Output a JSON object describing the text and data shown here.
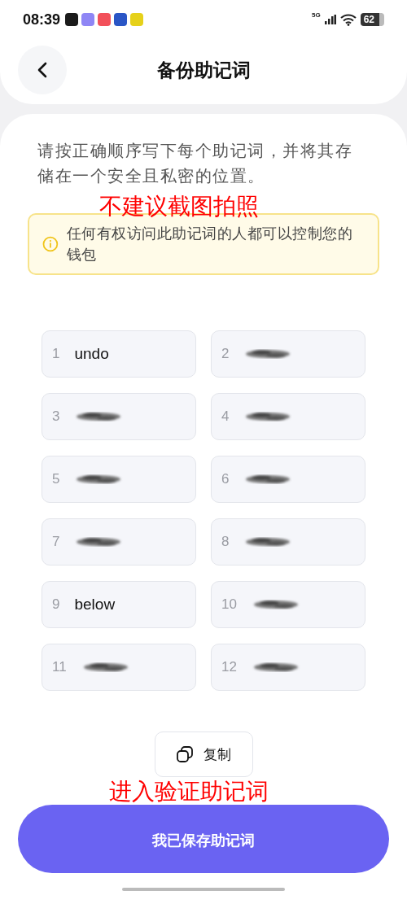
{
  "status_bar": {
    "time": "08:39",
    "app_icons": [
      {
        "color": "#1b1b1b"
      },
      {
        "color": "#8f86f5"
      },
      {
        "color": "#f2505a"
      },
      {
        "color": "#2a56c6"
      },
      {
        "color": "#e6d11a"
      }
    ],
    "network": "5G",
    "battery": "62"
  },
  "header": {
    "title": "备份助记词"
  },
  "instruction": "请按正确顺序写下每个助记词，并将其存储在一个安全且私密的位置。",
  "notice": {
    "annotation": "不建议截图拍照",
    "text": "任何有权访问此助记词的人都可以控制您的钱包"
  },
  "words": [
    {
      "number": "1",
      "kind": "text",
      "word": "undo"
    },
    {
      "number": "2",
      "kind": "blurred"
    },
    {
      "number": "3",
      "kind": "blurred"
    },
    {
      "number": "4",
      "kind": "blurred"
    },
    {
      "number": "5",
      "kind": "blurred"
    },
    {
      "number": "6",
      "kind": "blurred"
    },
    {
      "number": "7",
      "kind": "blurred"
    },
    {
      "number": "8",
      "kind": "blurred"
    },
    {
      "number": "9",
      "kind": "text",
      "word": "below"
    },
    {
      "number": "10",
      "kind": "blurred"
    },
    {
      "number": "11",
      "kind": "blurred"
    },
    {
      "number": "12",
      "kind": "blurred"
    }
  ],
  "copy_button": {
    "label": "复制"
  },
  "primary_button": {
    "annotation": "进入验证助记词",
    "label": "我已保存助记词"
  }
}
